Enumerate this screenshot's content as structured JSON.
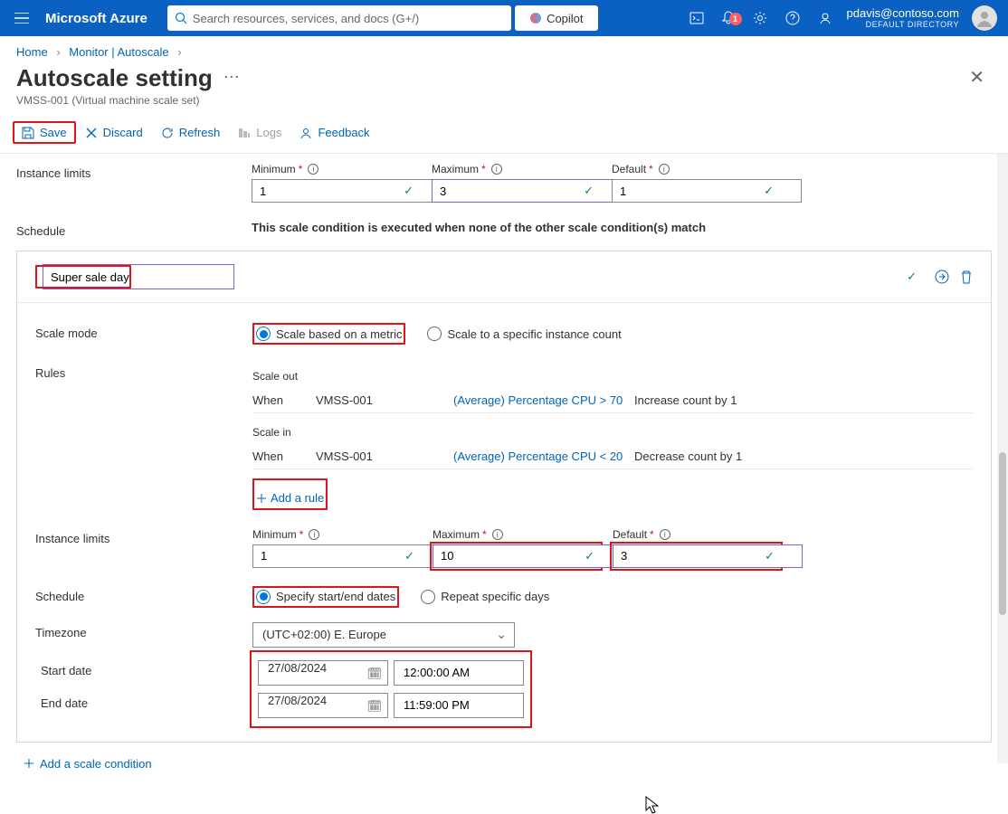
{
  "header": {
    "brand": "Microsoft Azure",
    "search_placeholder": "Search resources, services, and docs (G+/)",
    "copilot_label": "Copilot",
    "notification_badge": "1",
    "user_email": "pdavis@contoso.com",
    "directory": "DEFAULT DIRECTORY"
  },
  "breadcrumb": {
    "home": "Home",
    "monitor": "Monitor | Autoscale"
  },
  "page": {
    "title": "Autoscale setting",
    "subtitle": "VMSS-001 (Virtual machine scale set)"
  },
  "toolbar": {
    "save": "Save",
    "discard": "Discard",
    "refresh": "Refresh",
    "logs": "Logs",
    "feedback": "Feedback"
  },
  "labels": {
    "instance_limits": "Instance limits",
    "min": "Minimum",
    "max": "Maximum",
    "def": "Default",
    "schedule": "Schedule",
    "scale_mode": "Scale mode",
    "rules": "Rules",
    "timezone": "Timezone",
    "start_date": "Start date",
    "end_date": "End date"
  },
  "default_cond": {
    "min": "1",
    "max": "3",
    "def": "1",
    "schedule_msg": "This scale condition is executed when none of the other scale condition(s) match"
  },
  "cond2": {
    "name": "Super sale day",
    "scale_mode_metric": "Scale based on a metric",
    "scale_mode_specific": "Scale to a specific instance count",
    "scale_out_hdr": "Scale out",
    "scale_in_hdr": "Scale in",
    "when": "When",
    "resource": "VMSS-001",
    "out_metric": "(Average) Percentage CPU > 70",
    "out_action": "Increase count by 1",
    "in_metric": "(Average) Percentage CPU < 20",
    "in_action": "Decrease count by 1",
    "add_rule": "Add a rule",
    "min": "1",
    "max": "10",
    "def": "3",
    "sched_dates": "Specify start/end dates",
    "sched_repeat": "Repeat specific days",
    "timezone": "(UTC+02:00) E. Europe",
    "start_date": "27/08/2024",
    "start_time": "12:00:00 AM",
    "end_date": "27/08/2024",
    "end_time": "11:59:00 PM"
  },
  "add_cond": "Add a scale condition"
}
